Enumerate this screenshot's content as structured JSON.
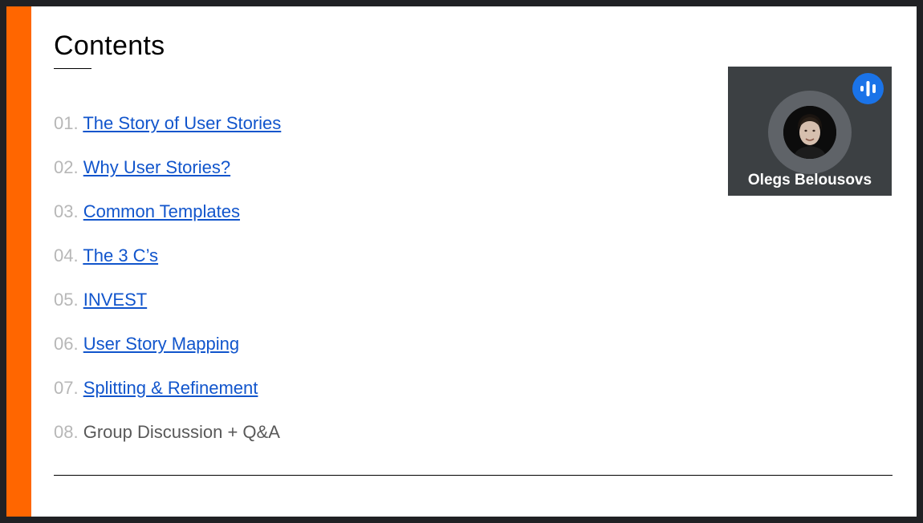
{
  "slide": {
    "title": "Contents",
    "items": [
      {
        "num": "01.",
        "label": "The Story of User Stories",
        "is_link": true
      },
      {
        "num": "02.",
        "label": "Why User Stories?",
        "is_link": true
      },
      {
        "num": "03.",
        "label": "Common Templates",
        "is_link": true
      },
      {
        "num": "04.",
        "label": "The 3 C’s",
        "is_link": true
      },
      {
        "num": "05.",
        "label": "INVEST",
        "is_link": true
      },
      {
        "num": "06.",
        "label": "User Story Mapping",
        "is_link": true
      },
      {
        "num": "07.",
        "label": "Splitting & Refinement",
        "is_link": true
      },
      {
        "num": "08.",
        "label": "Group Discussion + Q&A",
        "is_link": false
      }
    ]
  },
  "participant": {
    "name": "Olegs Belousovs",
    "speaking_icon": "audio-wave-icon",
    "avatar": "profile-photo"
  },
  "colors": {
    "accent_bar": "#ff6600",
    "link": "#1155cc",
    "number": "#b7b7b7",
    "plain_text": "#595959",
    "tile_bg": "#3c4043",
    "speaking_indicator": "#1a73e8"
  }
}
